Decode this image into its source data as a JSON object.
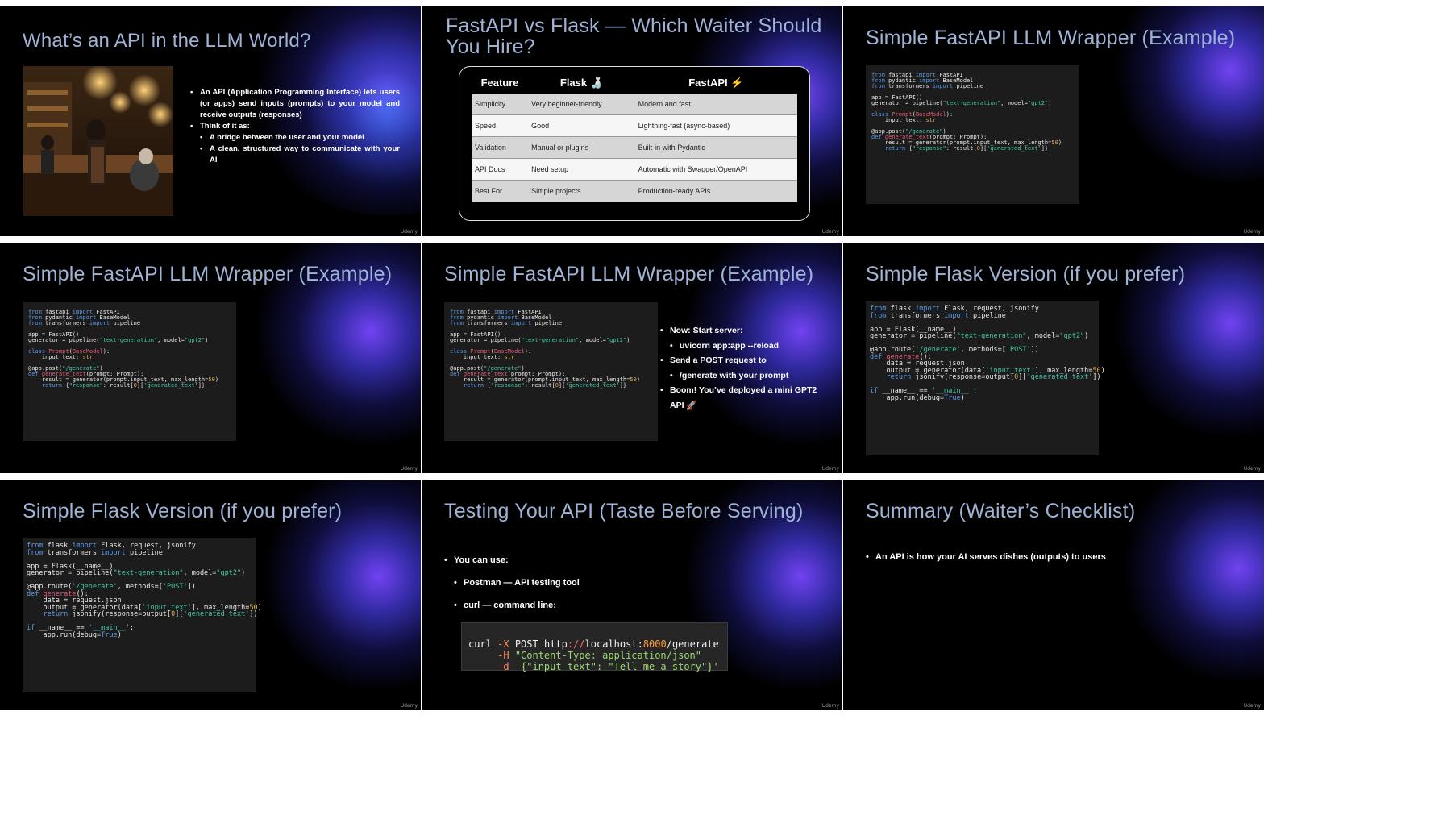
{
  "watermark": "Udemy",
  "slides": {
    "s1": {
      "title": "What’s an API in the LLM World?",
      "bullets": [
        "An API (Application Programming Interface) lets users (or apps) send inputs (prompts) to your model and receive outputs (responses)",
        "Think of it as:"
      ],
      "sub_bullets": [
        "A bridge between the user and your model",
        "A clean, structured way to communicate with your AI"
      ]
    },
    "s2": {
      "title": "FastAPI vs Flask — Which Waiter Should You Hire?",
      "headers": [
        "Feature",
        "Flask 🍶",
        "FastAPI ⚡"
      ],
      "rows": [
        [
          "Simplicity",
          "Very beginner-friendly",
          "Modern and fast"
        ],
        [
          "Speed",
          "Good",
          "Lightning-fast (async-based)"
        ],
        [
          "Validation",
          "Manual or plugins",
          "Built-in with Pydantic"
        ],
        [
          "API Docs",
          "Need setup",
          "Automatic with Swagger/OpenAPI"
        ],
        [
          "Best For",
          "Simple projects",
          "Production-ready APIs"
        ]
      ]
    },
    "s3": {
      "title": "Simple FastAPI LLM Wrapper (Example)"
    },
    "s4": {
      "title": "Simple FastAPI LLM Wrapper (Example)"
    },
    "s5": {
      "title": "Simple FastAPI LLM Wrapper (Example)",
      "bullets": {
        "b1": "Now: Start server:",
        "b1_sub": "uvicorn app:app --reload",
        "b2": "Send a POST request to",
        "b2_sub": "/generate with your prompt",
        "b3": "Boom! You’ve deployed a mini GPT2 API 🚀"
      }
    },
    "s6": {
      "title": "Simple Flask Version (if you prefer)"
    },
    "s7": {
      "title": "Simple Flask Version (if you prefer)"
    },
    "s8": {
      "title": "Testing Your API (Taste Before Serving)",
      "bullets": {
        "b1": "You can use:",
        "b2": "Postman — API testing tool",
        "b3": "curl — command line:"
      },
      "curl": {
        "l1_cmd": "curl",
        "l1_flag": "-X",
        "l1_method": "POST",
        "l1_proto": "http",
        "l1_sep": "://",
        "l1_host": "localhost:",
        "l1_port": "8000",
        "l1_path": "/generate",
        "l2_flag": "-H",
        "l2_val": "\"Content-Type: application/json\"",
        "l3_flag": "-d",
        "l3_val": "'{\"input_text\": \"Tell me a story\"}'"
      }
    },
    "s9": {
      "title": "Summary (Waiter’s Checklist)",
      "bullet": "An API is how your AI serves dishes (outputs) to users"
    }
  },
  "code": {
    "fastapi": [
      [
        [
          "kw",
          "from"
        ],
        [
          "t",
          " fastapi "
        ],
        [
          "kw",
          "import"
        ],
        [
          "t",
          " FastAPI"
        ]
      ],
      [
        [
          "kw",
          "from"
        ],
        [
          "t",
          " pydantic "
        ],
        [
          "kw",
          "import"
        ],
        [
          "t",
          " BaseModel"
        ]
      ],
      [
        [
          "kw",
          "from"
        ],
        [
          "t",
          " transformers "
        ],
        [
          "kw",
          "import"
        ],
        [
          "t",
          " pipeline"
        ]
      ],
      [],
      [
        [
          "t",
          "app = FastAPI()"
        ]
      ],
      [
        [
          "t",
          "generator = pipeline("
        ],
        [
          "str",
          "\"text-generation\""
        ],
        [
          "t",
          ", model="
        ],
        [
          "str",
          "\"gpt2\""
        ],
        [
          "t",
          ")"
        ]
      ],
      [],
      [
        [
          "kw",
          "class"
        ],
        [
          "t",
          " "
        ],
        [
          "cls",
          "Prompt"
        ],
        [
          "t",
          "("
        ],
        [
          "base",
          "BaseModel"
        ],
        [
          "t",
          "):"
        ]
      ],
      [
        [
          "t",
          "    input_text: "
        ],
        [
          "num",
          "str"
        ]
      ],
      [],
      [
        [
          "t",
          "@app.post("
        ],
        [
          "str",
          "\"/generate\""
        ],
        [
          "t",
          ")"
        ]
      ],
      [
        [
          "kw",
          "def"
        ],
        [
          "t",
          " "
        ],
        [
          "fn",
          "generate_text"
        ],
        [
          "t",
          "(prompt: Prompt):"
        ]
      ],
      [
        [
          "t",
          "    result = generator(prompt.input_text, max_length="
        ],
        [
          "num",
          "50"
        ],
        [
          "t",
          ")"
        ]
      ],
      [
        [
          "t",
          "    "
        ],
        [
          "kw",
          "return"
        ],
        [
          "t",
          " {"
        ],
        [
          "str",
          "\"response\""
        ],
        [
          "t",
          ": result["
        ],
        [
          "num",
          "0"
        ],
        [
          "t",
          "]["
        ],
        [
          "str",
          "'generated_text'"
        ],
        [
          "t",
          "]}"
        ]
      ]
    ],
    "flask": [
      [
        [
          "kw",
          "from"
        ],
        [
          "t",
          " flask "
        ],
        [
          "kw",
          "import"
        ],
        [
          "t",
          " Flask, request, jsonify"
        ]
      ],
      [
        [
          "kw",
          "from"
        ],
        [
          "t",
          " transformers "
        ],
        [
          "kw",
          "import"
        ],
        [
          "t",
          " pipeline"
        ]
      ],
      [],
      [
        [
          "t",
          "app = Flask(__name__)"
        ]
      ],
      [
        [
          "t",
          "generator = pipeline("
        ],
        [
          "str",
          "\"text-generation\""
        ],
        [
          "t",
          ", model="
        ],
        [
          "str",
          "\"gpt2\""
        ],
        [
          "t",
          ")"
        ]
      ],
      [],
      [
        [
          "t",
          "@app.route("
        ],
        [
          "str",
          "'/generate'"
        ],
        [
          "t",
          ", methods=["
        ],
        [
          "str",
          "'POST'"
        ],
        [
          "t",
          "])"
        ]
      ],
      [
        [
          "kw",
          "def"
        ],
        [
          "t",
          " "
        ],
        [
          "fn",
          "generate"
        ],
        [
          "t",
          "():"
        ]
      ],
      [
        [
          "t",
          "    data = request.json"
        ]
      ],
      [
        [
          "t",
          "    output = generator(data["
        ],
        [
          "str",
          "'input_text'"
        ],
        [
          "t",
          "], max_length="
        ],
        [
          "num",
          "50"
        ],
        [
          "t",
          ")"
        ]
      ],
      [
        [
          "t",
          "    "
        ],
        [
          "kw",
          "return"
        ],
        [
          "t",
          " jsonify(response=output["
        ],
        [
          "num",
          "0"
        ],
        [
          "t",
          "]["
        ],
        [
          "str",
          "'generated_text'"
        ],
        [
          "t",
          "])"
        ]
      ],
      [],
      [
        [
          "kw",
          "if"
        ],
        [
          "t",
          " __name__ == "
        ],
        [
          "str",
          "'__main__'"
        ],
        [
          "t",
          ":"
        ]
      ],
      [
        [
          "t",
          "    app.run(debug="
        ],
        [
          "kw",
          "True"
        ],
        [
          "t",
          ")"
        ]
      ]
    ]
  }
}
